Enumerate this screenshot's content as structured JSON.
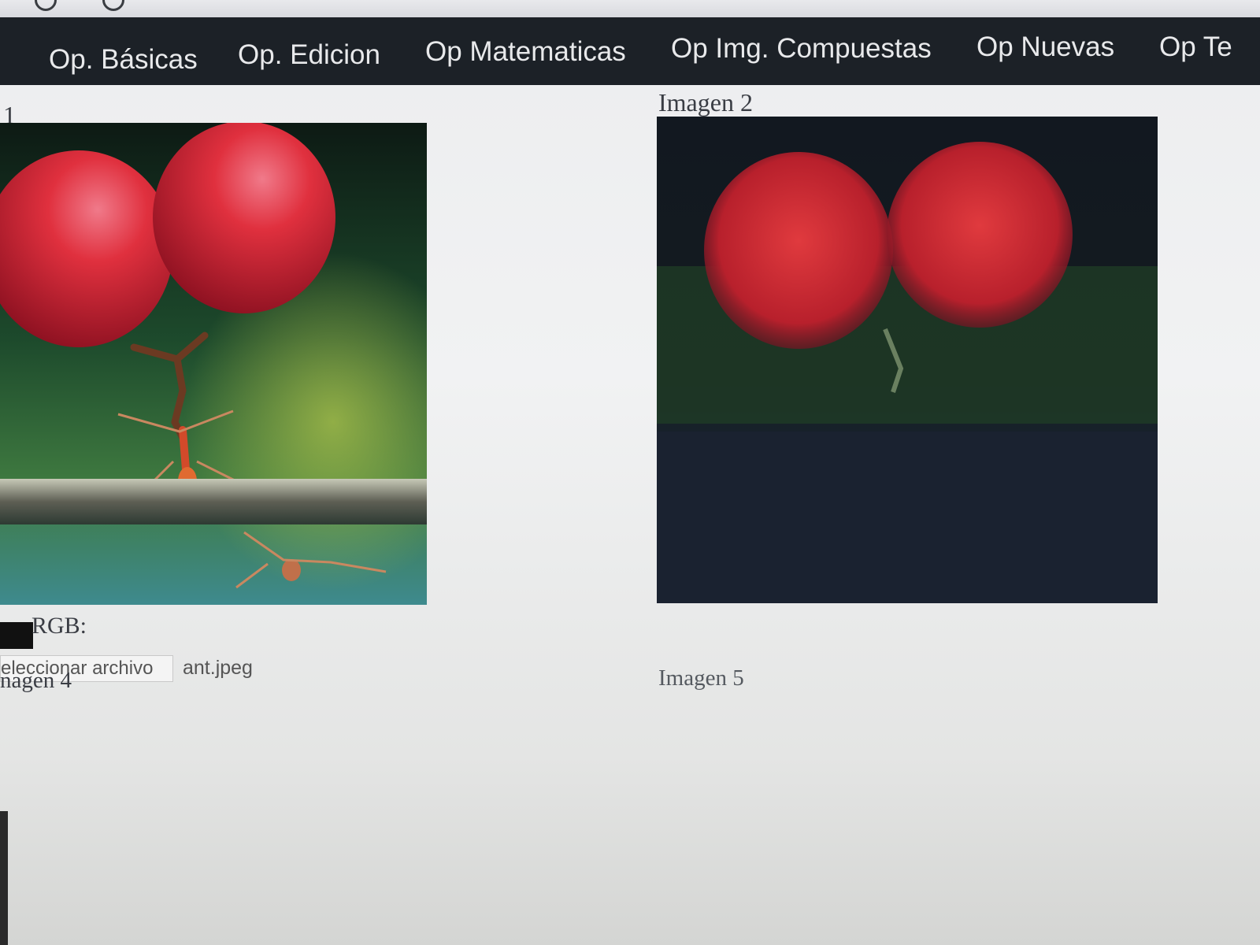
{
  "nav": {
    "items": [
      {
        "label": "Op. Básicas"
      },
      {
        "label": "Op. Edicion"
      },
      {
        "label": "Op Matematicas"
      },
      {
        "label": "Op Img. Compuestas"
      },
      {
        "label": "Op Nuevas"
      },
      {
        "label": "Op Te"
      }
    ]
  },
  "panels": {
    "image1_label": "1",
    "image2_label": "Imagen 2",
    "image4_label": "nagen 4",
    "image5_label": "Imagen 5"
  },
  "controls": {
    "rgb_label": "RGB:",
    "file_button_label": "eleccionar archivo",
    "file_name": "ant.jpeg"
  },
  "colors": {
    "navbar_bg": "#1c2127",
    "nav_text": "#e8e9eb",
    "page_bg": "#eeeff0"
  }
}
